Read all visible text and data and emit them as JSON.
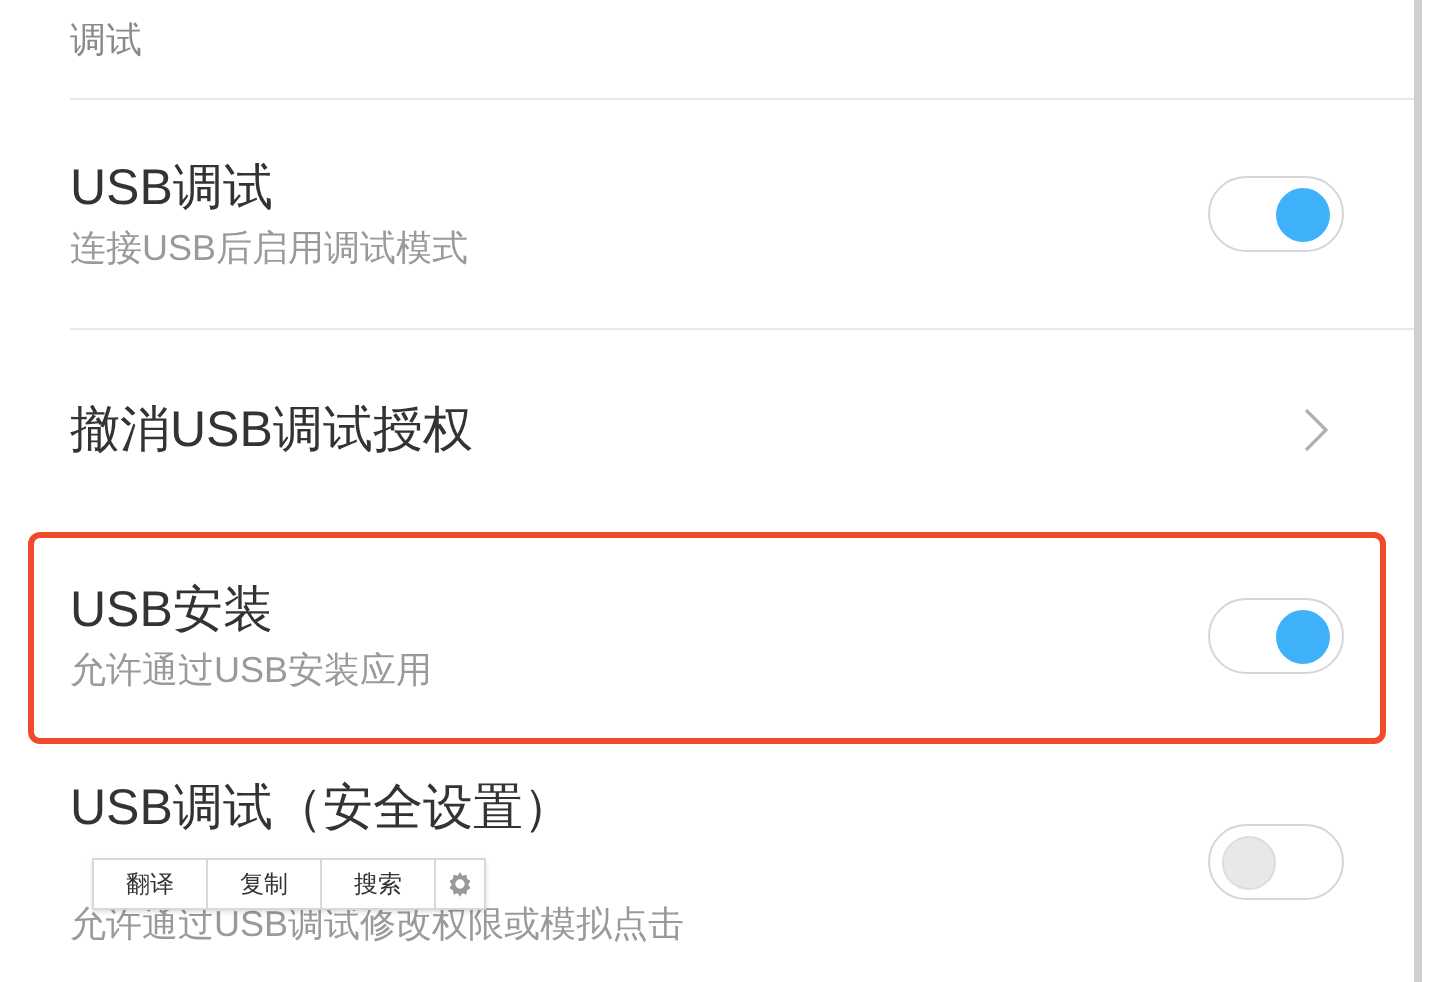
{
  "section_header": "调试",
  "items": [
    {
      "kind": "toggle",
      "title": "USB调试",
      "subtitle": "连接USB后启用调试模式",
      "on": true,
      "highlighted": false
    },
    {
      "kind": "link",
      "title": "撤消USB调试授权",
      "highlighted": false
    },
    {
      "kind": "toggle",
      "title": "USB安装",
      "subtitle": "允许通过USB安装应用",
      "on": true,
      "highlighted": true
    },
    {
      "kind": "toggle",
      "title": "USB调试（安全设置）",
      "subtitle": "允许通过USB调试修改权限或模拟点击",
      "on": false,
      "highlighted": false
    }
  ],
  "text_popup": {
    "actions": [
      "翻译",
      "复制",
      "搜索"
    ]
  }
}
